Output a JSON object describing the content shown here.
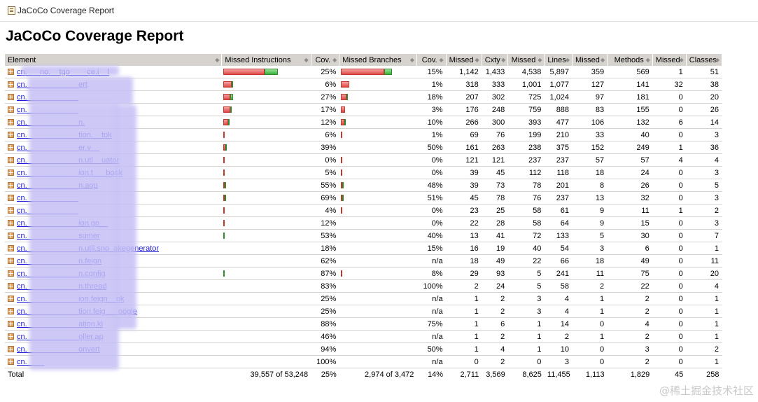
{
  "window": {
    "title": "JaCoCo Coverage Report"
  },
  "page": {
    "heading": "JaCoCo Coverage Report"
  },
  "columns": [
    "Element",
    "Missed Instructions",
    "Cov.",
    "Missed Branches",
    "Cov.",
    "Missed",
    "Cxty",
    "Missed",
    "Lines",
    "Missed",
    "Methods",
    "Missed",
    "Classes"
  ],
  "rows": [
    {
      "name": "cn.___no.__tgo____ce.i__l",
      "instr_cov": "25%",
      "instr_red": 59,
      "instr_green": 19,
      "br_cov": "15%",
      "br_red": 62,
      "br_green": 11,
      "missed_cxty": "1,142",
      "cxty": "1,433",
      "missed_lines": "4,538",
      "lines": "5,897",
      "missed_methods": "359",
      "methods": "569",
      "missed_classes": "1",
      "classes": "51"
    },
    {
      "name": "cn.____________ert",
      "instr_cov": "6%",
      "instr_red": 12,
      "instr_green": 1,
      "br_cov": "1%",
      "br_red": 12,
      "br_green": 0,
      "missed_cxty": "318",
      "cxty": "333",
      "missed_lines": "1,001",
      "lines": "1,077",
      "missed_methods": "127",
      "methods": "141",
      "missed_classes": "32",
      "classes": "38"
    },
    {
      "name": "cn.____________",
      "instr_cov": "27%",
      "instr_red": 10,
      "instr_green": 4,
      "br_cov": "18%",
      "br_red": 8,
      "br_green": 2,
      "missed_cxty": "207",
      "cxty": "302",
      "missed_lines": "725",
      "lines": "1,024",
      "missed_methods": "97",
      "methods": "181",
      "missed_classes": "0",
      "classes": "20"
    },
    {
      "name": "cn.____________",
      "instr_cov": "17%",
      "instr_red": 10,
      "instr_green": 2,
      "br_cov": "3%",
      "br_red": 6,
      "br_green": 0,
      "missed_cxty": "176",
      "cxty": "248",
      "missed_lines": "759",
      "lines": "888",
      "missed_methods": "83",
      "methods": "155",
      "missed_classes": "0",
      "classes": "26"
    },
    {
      "name": "cn.____________n.",
      "instr_cov": "12%",
      "instr_red": 7,
      "instr_green": 1,
      "br_cov": "10%",
      "br_red": 5,
      "br_green": 1,
      "missed_cxty": "266",
      "cxty": "300",
      "missed_lines": "393",
      "lines": "477",
      "missed_methods": "106",
      "methods": "132",
      "missed_classes": "6",
      "classes": "14"
    },
    {
      "name": "cn.____________tion.__tok",
      "instr_cov": "6%",
      "instr_red": 2,
      "instr_green": 0,
      "br_cov": "1%",
      "br_red": 2,
      "br_green": 0,
      "missed_cxty": "69",
      "cxty": "76",
      "missed_lines": "199",
      "lines": "210",
      "missed_methods": "33",
      "methods": "40",
      "missed_classes": "0",
      "classes": "3"
    },
    {
      "name": "cn.____________er.v__",
      "instr_cov": "39%",
      "instr_red": 3,
      "instr_green": 1,
      "br_cov": "50%",
      "br_red": 0,
      "br_green": 0,
      "missed_cxty": "161",
      "cxty": "263",
      "missed_lines": "238",
      "lines": "375",
      "missed_methods": "152",
      "methods": "249",
      "missed_classes": "1",
      "classes": "36"
    },
    {
      "name": "cn.____________n.utl__uator",
      "instr_cov": "0%",
      "instr_red": 2,
      "instr_green": 0,
      "br_cov": "0%",
      "br_red": 2,
      "br_green": 0,
      "missed_cxty": "121",
      "cxty": "121",
      "missed_lines": "237",
      "lines": "237",
      "missed_methods": "57",
      "methods": "57",
      "missed_classes": "4",
      "classes": "4"
    },
    {
      "name": "cn.____________ion.t___book",
      "instr_cov": "5%",
      "instr_red": 1,
      "instr_green": 0,
      "br_cov": "0%",
      "br_red": 1,
      "br_green": 0,
      "missed_cxty": "39",
      "cxty": "45",
      "missed_lines": "112",
      "lines": "118",
      "missed_methods": "18",
      "methods": "24",
      "missed_classes": "0",
      "classes": "3"
    },
    {
      "name": "cn.____________n.aop",
      "instr_cov": "55%",
      "instr_red": 1,
      "instr_green": 1,
      "br_cov": "48%",
      "br_red": 1,
      "br_green": 1,
      "missed_cxty": "39",
      "cxty": "73",
      "missed_lines": "78",
      "lines": "201",
      "missed_methods": "8",
      "methods": "26",
      "missed_classes": "0",
      "classes": "5"
    },
    {
      "name": "cn.____________",
      "instr_cov": "69%",
      "instr_red": 1,
      "instr_green": 1,
      "br_cov": "51%",
      "br_red": 1,
      "br_green": 1,
      "missed_cxty": "45",
      "cxty": "78",
      "missed_lines": "76",
      "lines": "237",
      "missed_methods": "13",
      "methods": "32",
      "missed_classes": "0",
      "classes": "3"
    },
    {
      "name": "cn.____________",
      "instr_cov": "4%",
      "instr_red": 1,
      "instr_green": 0,
      "br_cov": "0%",
      "br_red": 1,
      "br_green": 0,
      "missed_cxty": "23",
      "cxty": "25",
      "missed_lines": "58",
      "lines": "61",
      "missed_methods": "9",
      "methods": "11",
      "missed_classes": "1",
      "classes": "2"
    },
    {
      "name": "cn.____________ion.go__",
      "instr_cov": "12%",
      "instr_red": 1,
      "instr_green": 0,
      "br_cov": "0%",
      "br_red": 0,
      "br_green": 0,
      "missed_cxty": "22",
      "cxty": "28",
      "missed_lines": "58",
      "lines": "64",
      "missed_methods": "9",
      "methods": "15",
      "missed_classes": "0",
      "classes": "3"
    },
    {
      "name": "cn.____________sumer",
      "instr_cov": "53%",
      "instr_red": 0,
      "instr_green": 1,
      "br_cov": "40%",
      "br_red": 0,
      "br_green": 0,
      "missed_cxty": "13",
      "cxty": "41",
      "missed_lines": "72",
      "lines": "133",
      "missed_methods": "5",
      "methods": "30",
      "missed_classes": "0",
      "classes": "7"
    },
    {
      "name": "cn.____________n.util.sno_akegenerator",
      "instr_cov": "18%",
      "instr_red": 0,
      "instr_green": 0,
      "br_cov": "15%",
      "br_red": 0,
      "br_green": 0,
      "missed_cxty": "16",
      "cxty": "19",
      "missed_lines": "40",
      "lines": "54",
      "missed_methods": "3",
      "methods": "6",
      "missed_classes": "0",
      "classes": "1"
    },
    {
      "name": "cn.____________n.feign",
      "instr_cov": "62%",
      "instr_red": 0,
      "instr_green": 0,
      "br_cov": "n/a",
      "br_red": 0,
      "br_green": 0,
      "missed_cxty": "18",
      "cxty": "49",
      "missed_lines": "22",
      "lines": "66",
      "missed_methods": "18",
      "methods": "49",
      "missed_classes": "0",
      "classes": "11"
    },
    {
      "name": "cn.____________n.config",
      "instr_cov": "87%",
      "instr_red": 0,
      "instr_green": 2,
      "br_cov": "8%",
      "br_red": 1,
      "br_green": 0,
      "missed_cxty": "29",
      "cxty": "93",
      "missed_lines": "5",
      "lines": "241",
      "missed_methods": "11",
      "methods": "75",
      "missed_classes": "0",
      "classes": "20"
    },
    {
      "name": "cn.____________n.thread",
      "instr_cov": "83%",
      "instr_red": 0,
      "instr_green": 0,
      "br_cov": "100%",
      "br_red": 0,
      "br_green": 0,
      "missed_cxty": "2",
      "cxty": "24",
      "missed_lines": "5",
      "lines": "58",
      "missed_methods": "2",
      "methods": "22",
      "missed_classes": "0",
      "classes": "4"
    },
    {
      "name": "cn.____________ion.feign__ok",
      "instr_cov": "25%",
      "instr_red": 0,
      "instr_green": 0,
      "br_cov": "n/a",
      "br_red": 0,
      "br_green": 0,
      "missed_cxty": "1",
      "cxty": "2",
      "missed_lines": "3",
      "lines": "4",
      "missed_methods": "1",
      "methods": "2",
      "missed_classes": "0",
      "classes": "1"
    },
    {
      "name": "cn.____________tion.feig___oogle",
      "instr_cov": "25%",
      "instr_red": 0,
      "instr_green": 0,
      "br_cov": "n/a",
      "br_red": 0,
      "br_green": 0,
      "missed_cxty": "1",
      "cxty": "2",
      "missed_lines": "3",
      "lines": "4",
      "missed_methods": "1",
      "methods": "2",
      "missed_classes": "0",
      "classes": "1"
    },
    {
      "name": "cn.____________ation.kl",
      "instr_cov": "88%",
      "instr_red": 0,
      "instr_green": 0,
      "br_cov": "75%",
      "br_red": 0,
      "br_green": 0,
      "missed_cxty": "1",
      "cxty": "6",
      "missed_lines": "1",
      "lines": "14",
      "missed_methods": "0",
      "methods": "4",
      "missed_classes": "0",
      "classes": "1"
    },
    {
      "name": "cn.____________oller.ap",
      "instr_cov": "46%",
      "instr_red": 0,
      "instr_green": 0,
      "br_cov": "n/a",
      "br_red": 0,
      "br_green": 0,
      "missed_cxty": "1",
      "cxty": "2",
      "missed_lines": "1",
      "lines": "2",
      "missed_methods": "1",
      "methods": "2",
      "missed_classes": "0",
      "classes": "1"
    },
    {
      "name": "cn.____________onvert",
      "instr_cov": "94%",
      "instr_red": 0,
      "instr_green": 0,
      "br_cov": "50%",
      "br_red": 0,
      "br_green": 0,
      "missed_cxty": "1",
      "cxty": "4",
      "missed_lines": "1",
      "lines": "10",
      "missed_methods": "0",
      "methods": "3",
      "missed_classes": "0",
      "classes": "2"
    },
    {
      "name": "cn.____",
      "instr_cov": "100%",
      "instr_red": 0,
      "instr_green": 0,
      "br_cov": "n/a",
      "br_red": 0,
      "br_green": 0,
      "missed_cxty": "0",
      "cxty": "2",
      "missed_lines": "0",
      "lines": "3",
      "missed_methods": "0",
      "methods": "2",
      "missed_classes": "0",
      "classes": "1"
    }
  ],
  "total": {
    "label": "Total",
    "instr": "39,557 of 53,248",
    "instr_cov": "25%",
    "br": "2,974 of 3,472",
    "br_cov": "14%",
    "missed_cxty": "2,711",
    "cxty": "3,569",
    "missed_lines": "8,625",
    "lines": "11,455",
    "missed_methods": "1,113",
    "methods": "1,829",
    "missed_classes": "45",
    "classes": "258"
  },
  "watermark": "@稀土掘金技术社区"
}
